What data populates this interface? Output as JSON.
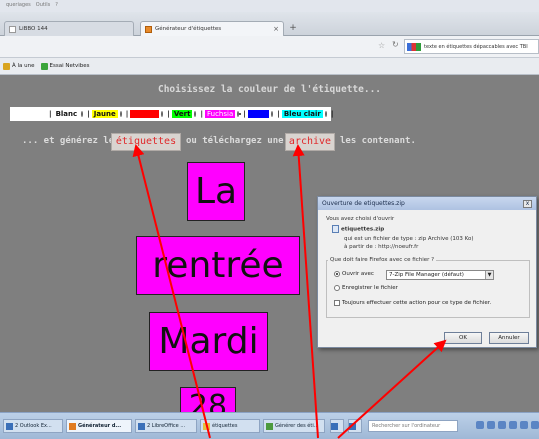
{
  "browser": {
    "menu": [
      "queriages",
      "Outils",
      "?"
    ],
    "tabs": [
      {
        "label": "LiBBO 144"
      },
      {
        "label": "Générateur d'étiquettes",
        "close": "×"
      }
    ],
    "new_tab": "+",
    "search_value": "texte en étiquettes dépaccables avec TBI",
    "bookmarks": [
      "À la une",
      "Essai Netvibes"
    ]
  },
  "page": {
    "heading": "Choisissez la couleur de l'étiquette...",
    "colors": [
      {
        "label": "Blanc",
        "color": "#ffffff",
        "text_color": "#111111",
        "checked": false
      },
      {
        "label": "Jaune",
        "color": "#ffff00",
        "text_color": "#111111",
        "checked": false
      },
      {
        "label": "Rouge",
        "color": "#ff0000",
        "text_color": "#ff0000",
        "checked": false
      },
      {
        "label": "Vert",
        "color": "#00ff00",
        "text_color": "#111111",
        "checked": false
      },
      {
        "label": "Fuchsia",
        "color": "#ff00ff",
        "text_color": "#ffffff",
        "checked": true
      },
      {
        "label": "Bleu",
        "color": "#0000ff",
        "text_color": "#0000ff",
        "checked": false
      },
      {
        "label": "Bleu clair",
        "color": "#00ffff",
        "text_color": "#111111",
        "checked": false
      }
    ],
    "subtext_before": "... et générez les",
    "etiquettes_btn": "étiquettes",
    "subtext_middle": "ou téléchargez une",
    "archive_btn": "archive",
    "subtext_after": "les contenant.",
    "labels": [
      "La",
      "rentrée",
      "Mardi",
      "28"
    ]
  },
  "dialog": {
    "title": "Ouverture de etiquettes.zip",
    "close": "x",
    "intro": "Vous avez choisi d'ouvrir",
    "filename": "etiquettes.zip",
    "type_line": "qui est un fichier de type : zip Archive (103 Ko)",
    "from_line": "à partir de : http://noeufr.fr",
    "question": "Que doit faire Firefox avec ce fichier ?",
    "open_with": "Ouvrir avec",
    "open_with_value": "7-Zip File Manager (défaut)",
    "save_file": "Enregistrer le fichier",
    "always": "Toujours effectuer cette action pour ce type de fichier.",
    "ok": "OK",
    "cancel": "Annuler"
  },
  "taskbar": {
    "items": [
      "2 Outlook Ex...",
      "Générateur d...",
      "2 LibreOffice ...",
      "étiquettes",
      "Générer des éti..."
    ],
    "search_placeholder": "Rechercher sur l'ordinateur"
  },
  "colors": {
    "label_fill": "#ff00ff",
    "annotation_arrow": "#ff0000"
  }
}
